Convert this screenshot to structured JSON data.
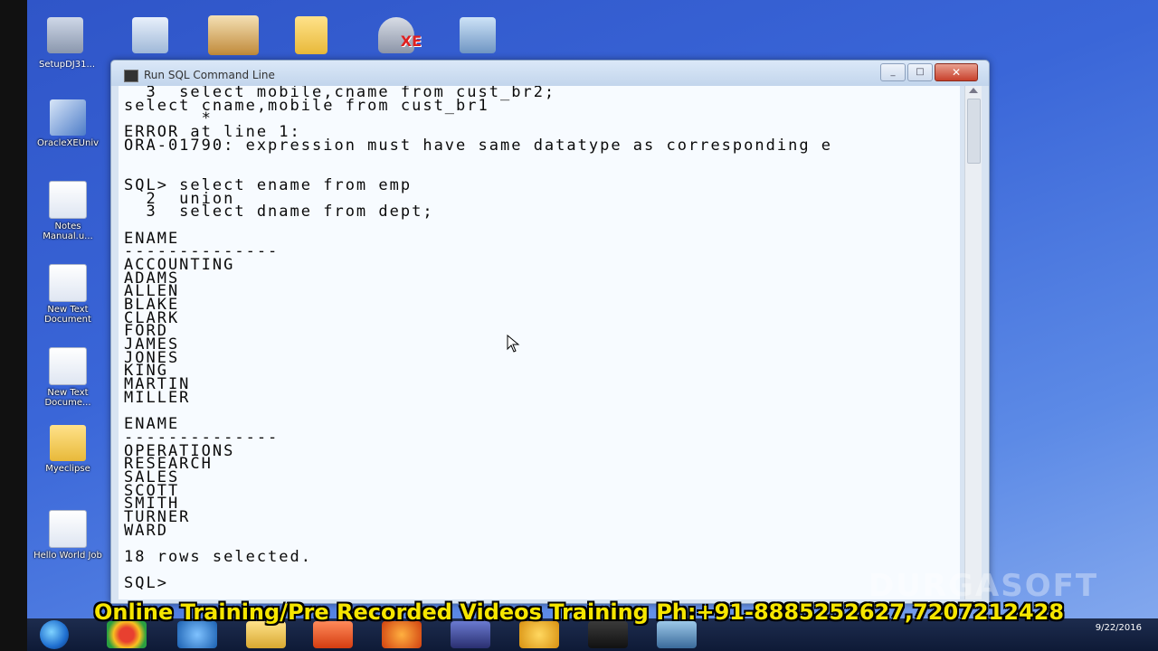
{
  "desktop": {
    "top_icons": [
      {
        "name": "setup-icon",
        "label": "SetupDJ31..."
      },
      {
        "name": "document-shortcut-icon",
        "label": ""
      },
      {
        "name": "tomcat-icon",
        "label": ""
      },
      {
        "name": "folder-icon",
        "label": ""
      },
      {
        "name": "oracle-xe-icon",
        "label": "XE"
      },
      {
        "name": "network-icon",
        "label": ""
      }
    ],
    "left_icons": [
      {
        "label": "OracleXEUniv"
      },
      {
        "label": "Notes Manual.u..."
      },
      {
        "label": "New Text Document"
      },
      {
        "label": "New Text Docume..."
      },
      {
        "label": "Myeclipse"
      },
      {
        "label": "Hello World Job"
      }
    ]
  },
  "window": {
    "title": "Run SQL Command Line",
    "close_label": "✕",
    "console_lines": [
      "  3  select mobile,cname from cust_br2;",
      "select cname,mobile from cust_br1",
      "       *",
      "ERROR at line 1:",
      "ORA-01790: expression must have same datatype as corresponding e",
      "",
      "",
      "SQL> select ename from emp",
      "  2  union",
      "  3  select dname from dept;",
      "",
      "ENAME",
      "--------------",
      "ACCOUNTING",
      "ADAMS",
      "ALLEN",
      "BLAKE",
      "CLARK",
      "FORD",
      "JAMES",
      "JONES",
      "KING",
      "MARTIN",
      "MILLER",
      "",
      "ENAME",
      "--------------",
      "OPERATIONS",
      "RESEARCH",
      "SALES",
      "SCOTT",
      "SMITH",
      "TURNER",
      "WARD",
      "",
      "18 rows selected.",
      "",
      "SQL> "
    ]
  },
  "banner": {
    "text": "Online Training/Pre Recorded Videos Training Ph:+91-8885252627,7207212428"
  },
  "watermark": {
    "text": "DURGASOFT"
  },
  "taskbar": {
    "date": "9/22/2016",
    "buttons": [
      "chrome-icon",
      "ie-icon",
      "explorer-icon",
      "media-player-icon",
      "firefox-icon",
      "eclipse-icon",
      "app-icon",
      "cmd-icon",
      "network-icon"
    ]
  },
  "colors": {
    "desktop": "#3a66d8",
    "console_bg": "#f7fbff",
    "banner_text": "#f6e600"
  }
}
